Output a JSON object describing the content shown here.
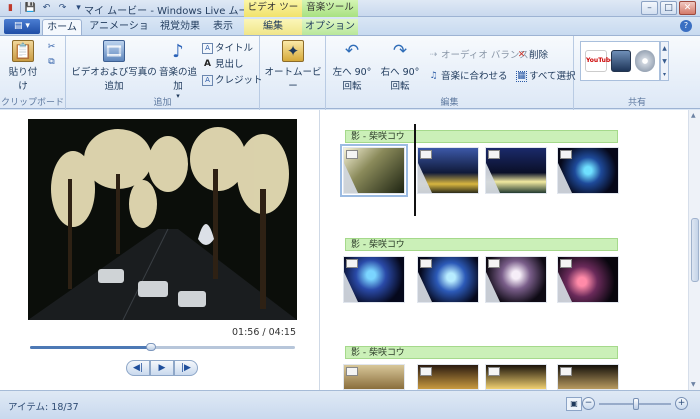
{
  "window": {
    "title": "マイ ムービー - Windows Live ムービー ...",
    "context_video": "ビデオ ツール",
    "context_music": "音楽ツール",
    "minimize": "–",
    "maximize": "□",
    "close": "✕"
  },
  "qat": {
    "save": "💾",
    "undo": "↶",
    "redo": "↷",
    "more": "▾"
  },
  "tabs": {
    "app_menu": "▤ ▾",
    "home": "ホーム",
    "animation": "アニメーション",
    "visual_effects": "視覚効果",
    "view": "表示",
    "edit": "編集",
    "options": "オプション",
    "help": "?"
  },
  "ribbon": {
    "clipboard": {
      "paste": "貼り付け",
      "cut_icon": "✂",
      "copy_icon": "⧉",
      "label": "クリップボード"
    },
    "add": {
      "add_video_photo": "ビデオおよび写真の追加",
      "add_music": "音楽の追加",
      "title": "タイトル",
      "caption": "見出し",
      "credits": "クレジット",
      "label": "追加"
    },
    "automovie": {
      "label": "オートムービー"
    },
    "edit": {
      "rotate_left": "左へ 90°回転",
      "rotate_right": "右へ 90°回転",
      "audio_balance": "オーディオ バランス",
      "fit_to_music": "音楽に合わせる",
      "delete": "削除",
      "select_all": "すべて選択",
      "label": "編集"
    },
    "share": {
      "youtube": "YouTube",
      "label": "共有"
    }
  },
  "preview": {
    "time_current": "01:56",
    "time_total": "04:15",
    "time_display": "01:56 / 04:15",
    "progress": 0.455,
    "prev_frame": "◀|",
    "play": "▶",
    "next_frame": "|▶"
  },
  "storyboard": {
    "music_label": "影 - 柴咲コウ",
    "rows": 3,
    "clips_per_row": 4
  },
  "statusbar": {
    "items_text": "アイテム: 18/37",
    "zoom_out": "−",
    "zoom_in": "+"
  }
}
